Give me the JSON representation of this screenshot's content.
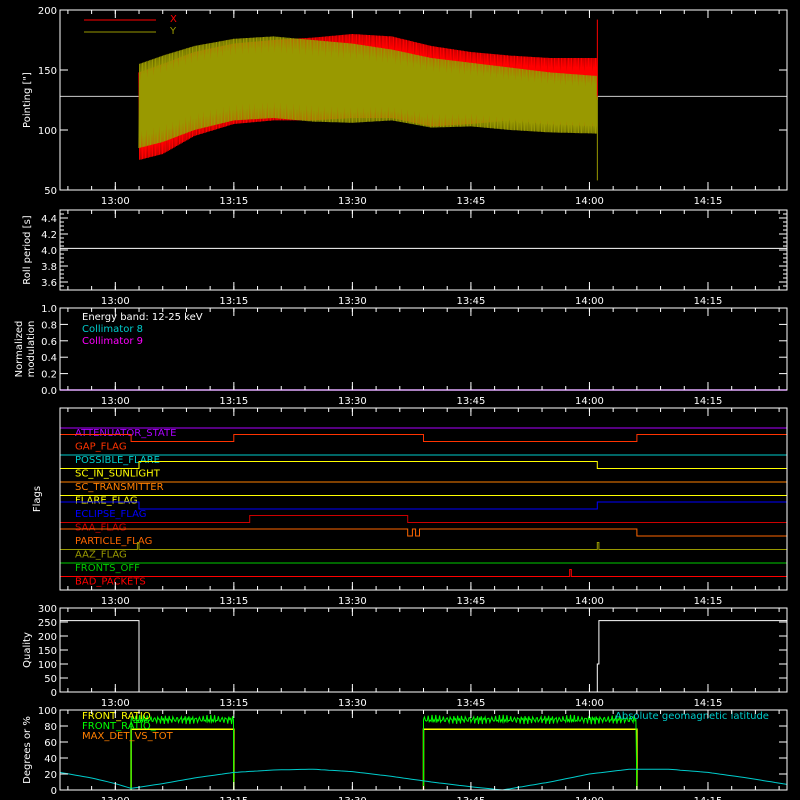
{
  "colors": {
    "background": "#000000",
    "axis": "#ffffff",
    "red": "#ff0000",
    "olive": "#999900",
    "purple": "#aa00ff",
    "cyan": "#00cccc",
    "orange": "#ff7f00",
    "yellow": "#ffff00",
    "blue": "#0000ff",
    "green": "#00ee00",
    "white": "#ffffff"
  },
  "time_ticks": [
    "13:00",
    "13:15",
    "13:30",
    "13:45",
    "14:00",
    "14:15"
  ],
  "chart_data": [
    {
      "type": "line",
      "id": "pointing",
      "ylabel": "Pointing [\"]",
      "ylim": [
        50,
        200
      ],
      "yticks": [
        "50",
        "100",
        "150",
        "200"
      ],
      "legend": [
        {
          "name": "X",
          "color": "#ff0000"
        },
        {
          "name": "Y",
          "color": "#999900"
        }
      ],
      "data_time_range": [
        "13:03",
        "14:01"
      ],
      "reference_line": {
        "y": 128,
        "color": "#cccccc"
      },
      "x_envelope": {
        "times": [
          "13:03",
          "13:06",
          "13:10",
          "13:15",
          "13:20",
          "13:25",
          "13:30",
          "13:35",
          "13:40",
          "13:45",
          "13:50",
          "13:55",
          "14:01"
        ],
        "upper": [
          148,
          155,
          165,
          172,
          175,
          177,
          180,
          178,
          170,
          165,
          162,
          160,
          160
        ],
        "lower": [
          75,
          80,
          95,
          105,
          108,
          108,
          110,
          110,
          103,
          105,
          108,
          105,
          103
        ]
      },
      "y_envelope": {
        "times": [
          "13:03",
          "13:06",
          "13:10",
          "13:15",
          "13:20",
          "13:25",
          "13:30",
          "13:35",
          "13:40",
          "13:45",
          "13:50",
          "13:55",
          "14:01"
        ],
        "upper": [
          155,
          162,
          170,
          176,
          178,
          175,
          172,
          167,
          160,
          156,
          152,
          148,
          145
        ],
        "lower": [
          85,
          90,
          100,
          108,
          110,
          107,
          106,
          108,
          102,
          103,
          100,
          98,
          97
        ]
      }
    },
    {
      "type": "line",
      "id": "roll_period",
      "ylabel": "Roll period [s]",
      "ylim": [
        3.5,
        4.5
      ],
      "yticks": [
        "3.6",
        "3.8",
        "4.0",
        "4.2",
        "4.4"
      ],
      "series": [
        {
          "times": [
            "12:53",
            "14:25"
          ],
          "values": [
            4.02,
            4.02
          ],
          "color": "#ffffff"
        }
      ]
    },
    {
      "type": "line",
      "id": "modulation",
      "ylabel": [
        "Normalized",
        "modulation"
      ],
      "ylim": [
        0,
        1
      ],
      "yticks": [
        "0.0",
        "0.2",
        "0.4",
        "0.6",
        "0.8",
        "1.0"
      ],
      "annotations": [
        {
          "text": "Energy band: 12-25 keV",
          "color": "#ffffff"
        },
        {
          "text": "Collimator 8",
          "color": "#00cccc"
        },
        {
          "text": "Collimator 9",
          "color": "#ff00ff"
        }
      ],
      "series": [
        {
          "times": [
            "12:53",
            "14:25"
          ],
          "values": [
            0,
            0
          ],
          "color": "#aa00ff"
        }
      ]
    },
    {
      "type": "line",
      "id": "flags",
      "ylabel": "Flags",
      "flags": [
        {
          "name": "ATTENUATOR_STATE",
          "color": "#aa00ff",
          "highs": []
        },
        {
          "name": "GAP_FLAG",
          "color": "#ff3300",
          "highs": [
            [
              "12:53",
              "13:02"
            ],
            [
              "13:15",
              "13:39"
            ],
            [
              "14:06",
              "14:25"
            ]
          ]
        },
        {
          "name": "POSSIBLE_FLARE",
          "color": "#00cccc",
          "highs": []
        },
        {
          "name": "SC_IN_SUNLIGHT",
          "color": "#ffff00",
          "highs": [
            [
              "13:03",
              "14:01"
            ]
          ]
        },
        {
          "name": "SC_TRANSMITTER",
          "color": "#ff7f00",
          "highs": []
        },
        {
          "name": "FLARE_FLAG",
          "color": "#ffff00",
          "highs": []
        },
        {
          "name": "ECLIPSE_FLAG",
          "color": "#0000ff",
          "highs": [
            [
              "12:53",
              "13:03"
            ],
            [
              "14:01",
              "14:25"
            ]
          ]
        },
        {
          "name": "SAA_FLAG",
          "color": "#cc0000",
          "highs": [
            [
              "13:17",
              "13:37"
            ]
          ]
        },
        {
          "name": "PARTICLE_FLAG",
          "color": "#ff6600",
          "highs": [
            [
              "12:53",
              "13:37"
            ],
            [
              "13:37.6",
              "13:38"
            ],
            [
              "13:38.5",
              "14:06"
            ]
          ]
        },
        {
          "name": "AAZ_FLAG",
          "color": "#999900",
          "highs": [
            [
              "13:02.8",
              "13:03"
            ],
            [
              "14:01",
              "14:01.2"
            ]
          ]
        },
        {
          "name": "FRONTS_OFF",
          "color": "#00cc00",
          "highs": []
        },
        {
          "name": "BAD_PACKETS",
          "color": "#ff0000",
          "highs": [
            [
              "13:57.5",
              "13:57.7"
            ]
          ]
        }
      ]
    },
    {
      "type": "line",
      "id": "quality",
      "ylabel": "Quality",
      "ylim": [
        0,
        300
      ],
      "yticks": [
        "0",
        "50",
        "100",
        "150",
        "200",
        "250",
        "300"
      ],
      "series": [
        {
          "times": [
            "12:53",
            "13:03",
            "13:03",
            "14:01",
            "14:01",
            "14:01.2",
            "14:01.2",
            "14:25"
          ],
          "values": [
            255,
            255,
            0,
            0,
            100,
            100,
            255,
            255
          ],
          "color": "#ffffff"
        }
      ]
    },
    {
      "type": "line",
      "id": "ratios",
      "ylabel": "Degrees or %",
      "ylim": [
        0,
        100
      ],
      "yticks": [
        "0",
        "20",
        "40",
        "60",
        "80",
        "100"
      ],
      "legend": [
        {
          "name": "FRONT_RATIO",
          "color": "#ffff00"
        },
        {
          "name": "FRONT_RATIO_",
          "color": "#00ff00"
        },
        {
          "name": "MAX_DET_VS_TOT",
          "color": "#ff7f00"
        }
      ],
      "annotations": [
        {
          "text": "Absolute geomagnetic latitude",
          "color": "#00cccc"
        }
      ],
      "front_ratio_green": {
        "segments": [
          [
            "13:02",
            "13:15"
          ],
          [
            "13:39",
            "14:06"
          ]
        ],
        "value": 88,
        "noise": 6
      },
      "front_ratio_yellow": {
        "segments": [
          [
            "13:02",
            "13:15"
          ],
          [
            "13:39",
            "14:06"
          ]
        ],
        "value": 76
      },
      "latitude": {
        "times": [
          "12:53",
          "12:57",
          "13:00",
          "13:02",
          "13:06",
          "13:10",
          "13:15",
          "13:20",
          "13:25",
          "13:30",
          "13:35",
          "13:40",
          "13:45",
          "13:49",
          "13:55",
          "14:00",
          "14:05",
          "14:10",
          "14:15",
          "14:20",
          "14:25"
        ],
        "values": [
          22,
          15,
          8,
          2,
          8,
          15,
          22,
          25,
          26,
          23,
          17,
          10,
          4,
          0,
          10,
          20,
          26,
          26,
          22,
          15,
          7
        ]
      }
    }
  ]
}
